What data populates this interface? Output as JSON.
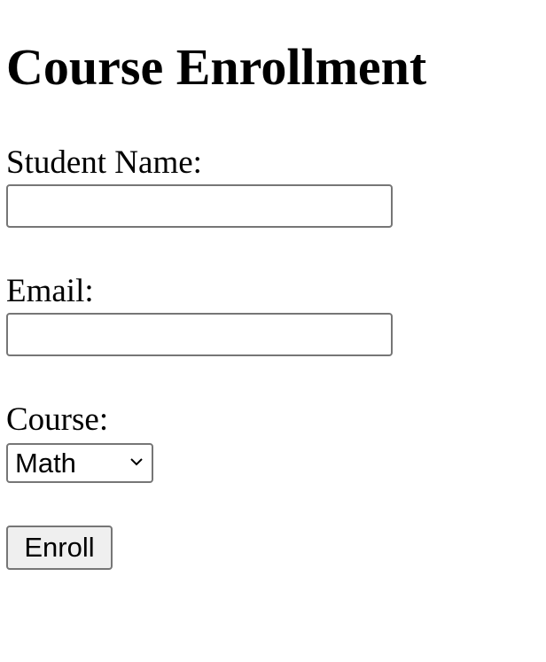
{
  "page": {
    "title": "Course Enrollment"
  },
  "form": {
    "name_label": "Student Name:",
    "name_value": "",
    "email_label": "Email:",
    "email_value": "",
    "course_label": "Course:",
    "course_selected": "Math",
    "course_dropdown_icon": "chevron-down-icon",
    "submit_label": "Enroll"
  }
}
